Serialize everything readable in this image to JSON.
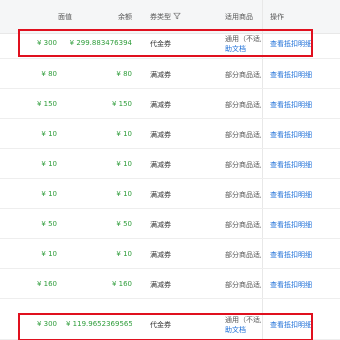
{
  "columns": {
    "face_value": "面值",
    "balance": "余额",
    "coupon_type": "券类型",
    "scope": "适用商品",
    "action": "操作"
  },
  "rows": [
    {
      "face_value": "¥ 300",
      "balance": "¥ 299.883476394",
      "coupon_type": "代金券",
      "scope": "通用（不适用",
      "scope_link": "助文档",
      "action": "查看抵扣明细",
      "highlighted": true
    },
    {
      "face_value": "¥ 80",
      "balance": "¥ 80",
      "coupon_type": "满减券",
      "scope": "部分商品适用",
      "action": "查看抵扣明细"
    },
    {
      "face_value": "¥ 150",
      "balance": "¥ 150",
      "coupon_type": "满减券",
      "scope": "部分商品适用",
      "action": "查看抵扣明细"
    },
    {
      "face_value": "¥ 10",
      "balance": "¥ 10",
      "coupon_type": "满减券",
      "scope": "部分商品适用",
      "action": "查看抵扣明细"
    },
    {
      "face_value": "¥ 10",
      "balance": "¥ 10",
      "coupon_type": "满减券",
      "scope": "部分商品适用",
      "action": "查看抵扣明细"
    },
    {
      "face_value": "¥ 10",
      "balance": "¥ 10",
      "coupon_type": "满减券",
      "scope": "部分商品适用",
      "action": "查看抵扣明细"
    },
    {
      "face_value": "¥ 50",
      "balance": "¥ 50",
      "coupon_type": "满减券",
      "scope": "部分商品适用",
      "action": "查看抵扣明细"
    },
    {
      "face_value": "¥ 10",
      "balance": "¥ 10",
      "coupon_type": "满减券",
      "scope": "部分商品适用",
      "action": "查看抵扣明细"
    },
    {
      "face_value": "¥ 160",
      "balance": "¥ 160",
      "coupon_type": "满减券",
      "scope": "部分商品适用",
      "action": "查看抵扣明细"
    },
    {
      "face_value": "¥ 300",
      "balance": "¥ 119.9652369565",
      "coupon_type": "代金券",
      "scope": "通用（不适用",
      "scope_link": "助文档",
      "action": "查看抵扣明细",
      "highlighted": true
    }
  ],
  "colors": {
    "amount": "#2e9d3a",
    "link": "#1d6fd8",
    "highlight_border": "#e0101e",
    "header_bg": "#f5f6f7"
  },
  "icons": {
    "filter": "filter-icon"
  }
}
